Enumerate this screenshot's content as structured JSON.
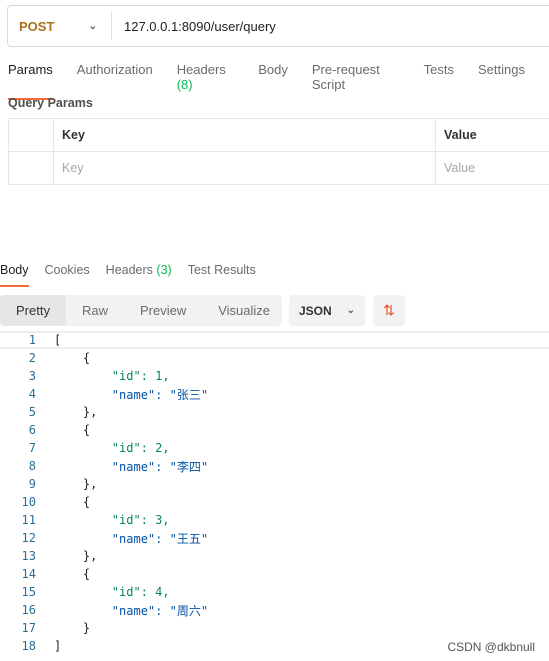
{
  "request": {
    "method": "POST",
    "url": "127.0.0.1:8090/user/query"
  },
  "tabs": [
    {
      "label": "Params"
    },
    {
      "label": "Authorization"
    },
    {
      "label": "Headers",
      "count": "(8)"
    },
    {
      "label": "Body"
    },
    {
      "label": "Pre-request Script"
    },
    {
      "label": "Tests"
    },
    {
      "label": "Settings"
    }
  ],
  "query_params": {
    "title": "Query Params",
    "col_key": "Key",
    "col_value": "Value",
    "ph_key": "Key",
    "ph_value": "Value"
  },
  "response_tabs": [
    {
      "label": "Body"
    },
    {
      "label": "Cookies"
    },
    {
      "label": "Headers",
      "count": "(3)"
    },
    {
      "label": "Test Results"
    }
  ],
  "view_modes": [
    "Pretty",
    "Raw",
    "Preview",
    "Visualize"
  ],
  "format": "JSON",
  "colors": {
    "accent": "#f26b3a",
    "method": "#a8711a",
    "key": "#a3247a",
    "number": "#098658",
    "string": "#0451a5"
  },
  "json_lines": [
    "[",
    "    {",
    "        \"id\": 1,",
    "        \"name\": \"张三\"",
    "    },",
    "    {",
    "        \"id\": 2,",
    "        \"name\": \"李四\"",
    "    },",
    "    {",
    "        \"id\": 3,",
    "        \"name\": \"王五\"",
    "    },",
    "    {",
    "        \"id\": 4,",
    "        \"name\": \"周六\"",
    "    }",
    "]"
  ],
  "watermark": "CSDN @dkbnull"
}
